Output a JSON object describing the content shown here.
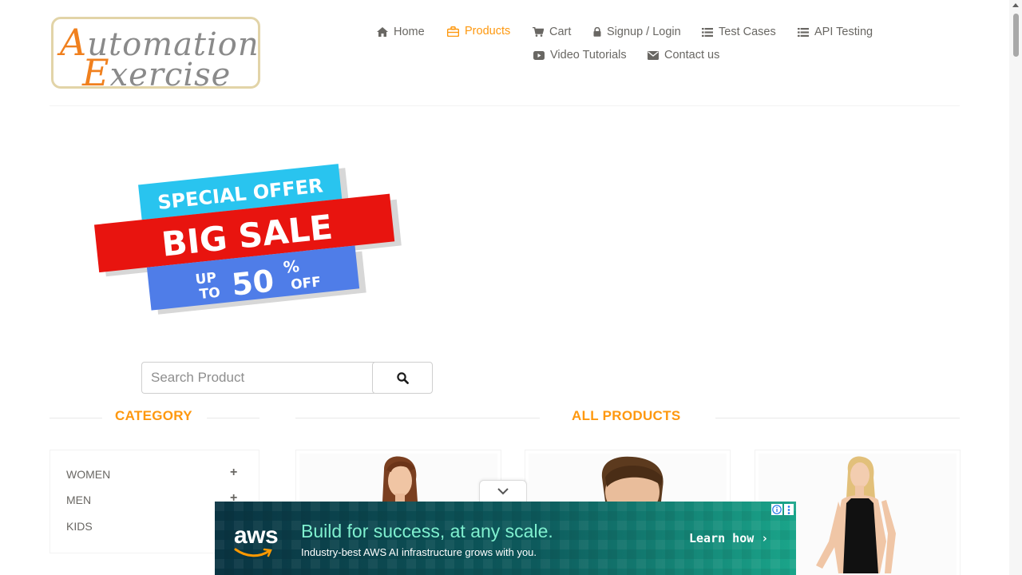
{
  "logo": {
    "line1_cap": "A",
    "line1_rest": "utomation",
    "line2_cap": "E",
    "line2_rest": "xercise"
  },
  "nav": {
    "active": "Products",
    "items": [
      {
        "label": "Home",
        "icon": "home-icon"
      },
      {
        "label": "Products",
        "icon": "briefcase-icon"
      },
      {
        "label": "Cart",
        "icon": "cart-icon"
      },
      {
        "label": "Signup / Login",
        "icon": "lock-icon"
      },
      {
        "label": "Test Cases",
        "icon": "list-icon"
      },
      {
        "label": "API Testing",
        "icon": "list-icon"
      },
      {
        "label": "Video Tutorials",
        "icon": "youtube-icon"
      },
      {
        "label": "Contact us",
        "icon": "envelope-icon"
      }
    ]
  },
  "promo": {
    "line1": "SPECIAL OFFER",
    "line2": "BIG SALE",
    "up": "UP",
    "to": "TO",
    "amount": "50",
    "percent": "%",
    "off": "OFF",
    "colors": {
      "cyan": "#29c4ef",
      "red": "#e8140f",
      "blue": "#4f7de8"
    }
  },
  "search": {
    "placeholder": "Search Product",
    "value": "",
    "button_icon": "search-icon"
  },
  "sections": {
    "category": "CATEGORY",
    "all_products": "ALL PRODUCTS"
  },
  "categories": [
    {
      "label": "WOMEN",
      "toggle": "+"
    },
    {
      "label": "MEN",
      "toggle": "+"
    },
    {
      "label": "KIDS",
      "toggle": "+"
    }
  ],
  "ad": {
    "logo": "aws",
    "headline": "Build for success, at any scale.",
    "subline": "Industry-best AWS AI infrastructure grows with you.",
    "cta": "Learn how ›",
    "info_icon": "info-icon",
    "more_icon": "more-vertical-icon",
    "toggle_icon": "chevron-down-icon"
  },
  "colors": {
    "accent": "#fe980f",
    "text": "#696763"
  }
}
